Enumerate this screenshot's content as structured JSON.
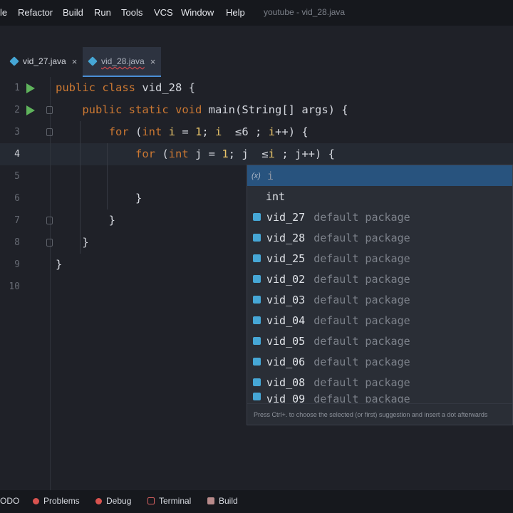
{
  "menu": {
    "items": [
      "le",
      "Refactor",
      "Build",
      "Run",
      "Tools",
      "VCS",
      "Window",
      "Help"
    ],
    "title": "youtube - vid_28.java"
  },
  "tabs": [
    {
      "label": "vid_27.java",
      "close": "×"
    },
    {
      "label": "vid_28.java",
      "close": "×"
    }
  ],
  "gutter": {
    "line_numbers": [
      "1",
      "2",
      "3",
      "4",
      "5",
      "6",
      "7",
      "8",
      "9",
      "10"
    ]
  },
  "code": {
    "lines": [
      "public class vid_28 {",
      "    public static void main(String[] args) {",
      "        for (int i = 1; i  ≤6 ; i++) {",
      "            for (int j = 1; j  ≤i ; j++) {",
      "",
      "            }",
      "        }",
      "    }",
      "}",
      ""
    ]
  },
  "autocomplete": {
    "selected": {
      "type_icon": "(x)",
      "name": "i"
    },
    "keyword": "int",
    "items": [
      {
        "name": "vid_27",
        "package": "default package"
      },
      {
        "name": "vid_28",
        "package": "default package"
      },
      {
        "name": "vid_25",
        "package": "default package"
      },
      {
        "name": "vid_02",
        "package": "default package"
      },
      {
        "name": "vid_03",
        "package": "default package"
      },
      {
        "name": "vid_04",
        "package": "default package"
      },
      {
        "name": "vid_05",
        "package": "default package"
      },
      {
        "name": "vid_06",
        "package": "default package"
      },
      {
        "name": "vid_08",
        "package": "default package"
      },
      {
        "name": "vid_09",
        "package": "default package"
      }
    ],
    "footer": "Press Ctrl+. to choose the selected (or first) suggestion and insert a dot afterwards"
  },
  "bottom_bar": {
    "items": [
      {
        "label": "ODO"
      },
      {
        "label": "Problems"
      },
      {
        "label": "Debug"
      },
      {
        "label": "Terminal"
      },
      {
        "label": "Build"
      }
    ]
  },
  "colors": {
    "keyword": "#cc7832",
    "variable": "#e8c46a",
    "number": "#e8c46a",
    "run": "#5fb35c",
    "selection": "#28537e"
  }
}
